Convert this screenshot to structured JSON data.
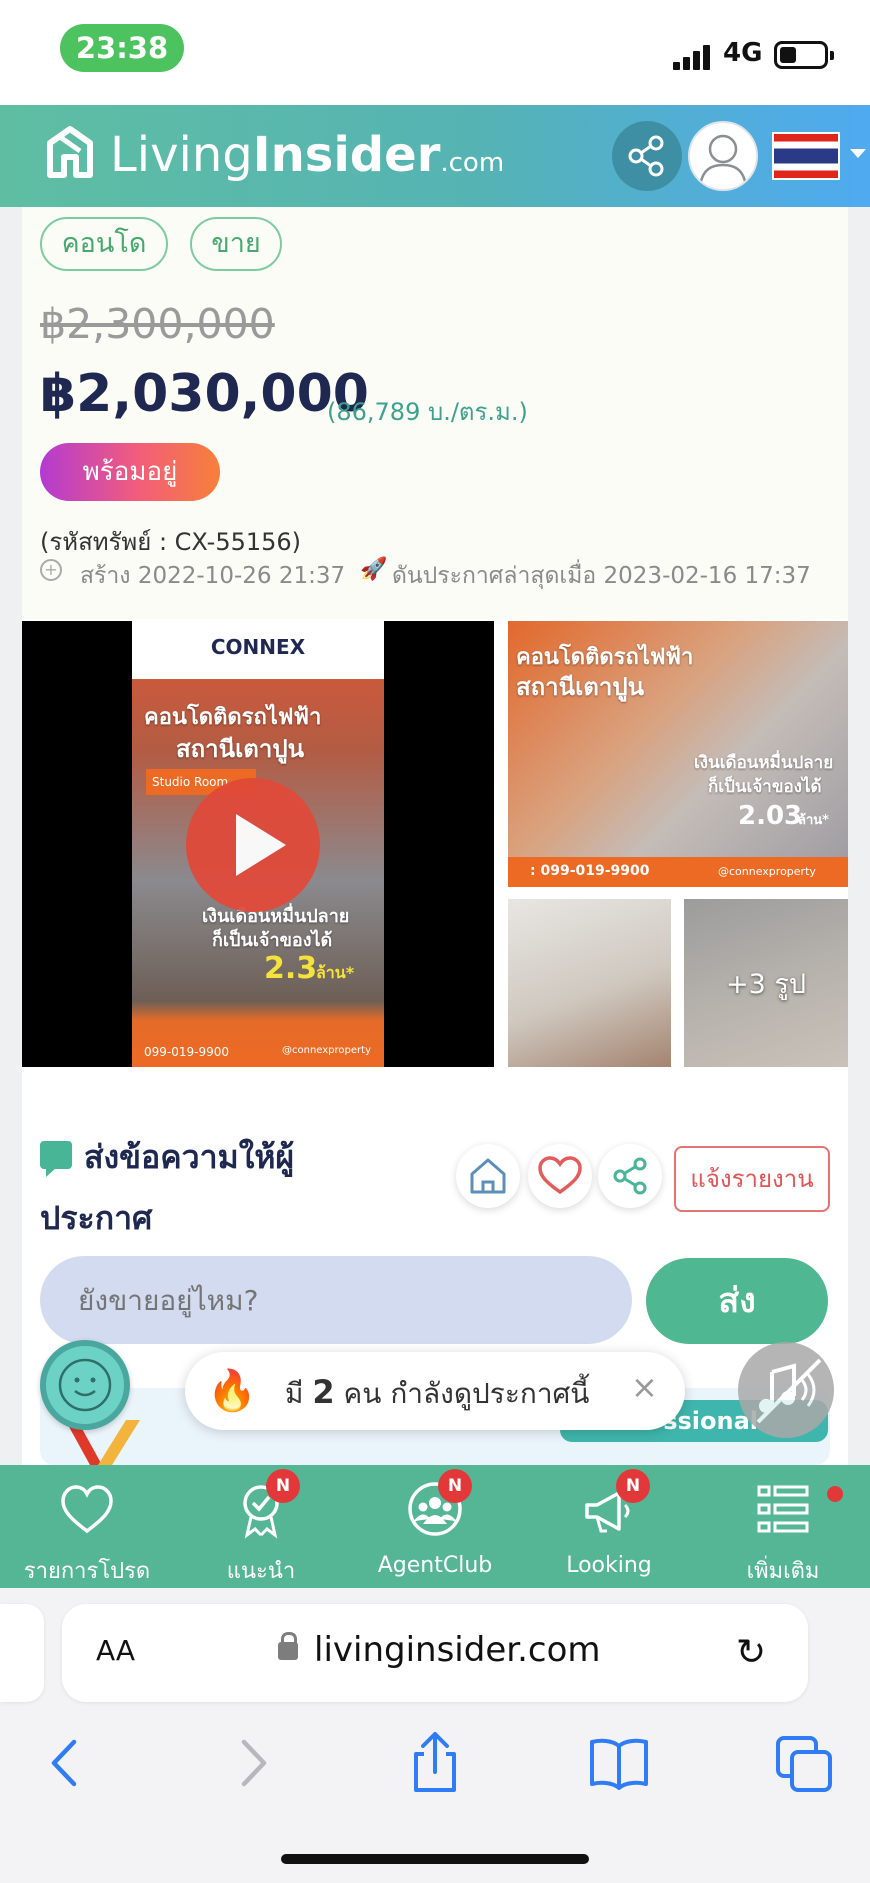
{
  "status_bar": {
    "time": "23:38",
    "network": "4G"
  },
  "header": {
    "logo_light": "Living",
    "logo_bold": "Insider",
    "logo_suffix": ".com",
    "icons": [
      "share-icon",
      "avatar",
      "thai-flag",
      "chevron-down-icon"
    ]
  },
  "listing": {
    "tags": [
      "คอนโด",
      "ขาย"
    ],
    "old_price": "฿2,300,000",
    "price": "฿2,030,000",
    "price_per_sqm": "(86,789 บ./ตร.ม.)",
    "ready_label": "พร้อมอยู่",
    "asset_code": "(รหัสทรัพย์ : CX-55156)",
    "created": "สร้าง 2022-10-26 21:37",
    "bumped": "ดันประกาศล่าสุดเมื่อ 2023-02-16 17:37"
  },
  "gallery": {
    "video": {
      "brand": "CONNEX",
      "headline_1": "คอนโดติดรถไฟฟ้า",
      "headline_2": "สถานีเตาปูน",
      "room": "Studio Room",
      "tagline_1": "เงินเดือนหมื่นปลาย",
      "tagline_2": "ก็เป็นเจ้าของได้",
      "price": "2.3",
      "price_unit": "ล้าน*",
      "phone": "099-019-9900",
      "handle": "@connexproperty"
    },
    "main_image": {
      "headline_1": "คอนโดติดรถไฟฟ้า",
      "headline_2": "สถานีเตาปูน",
      "tagline_1": "เงินเดือนหมื่นปลาย",
      "tagline_2": "ก็เป็นเจ้าของได้",
      "price": "2.03",
      "price_unit": "ล้าน*",
      "phone": ": 099-019-9900",
      "handle": "@connexproperty"
    },
    "more_photos": "+3 รูป"
  },
  "message": {
    "title_line1": "ส่งข้อความให้ผู้",
    "title_line2": "ประกาศ",
    "report_label": "แจ้งรายงาน",
    "input_placeholder": "ยังขายอยู่ไหม?",
    "send_label": "ส่ง",
    "pro_badge": "ssional"
  },
  "viewers_toast": {
    "prefix": "มี",
    "count": "2",
    "suffix": "คน กำลังดูประกาศนี้",
    "close": "×"
  },
  "app_nav": {
    "items": [
      {
        "label": "รายการโปรด",
        "icon": "heart-icon",
        "badge": ""
      },
      {
        "label": "แนะนำ",
        "icon": "award-icon",
        "badge": "N"
      },
      {
        "label": "AgentClub",
        "icon": "group-icon",
        "badge": "N"
      },
      {
        "label": "Looking",
        "icon": "megaphone-icon",
        "badge": "N"
      },
      {
        "label": "เพิ่มเติม",
        "icon": "list-icon",
        "badge": ""
      }
    ]
  },
  "browser": {
    "aa_label": "AA",
    "url": "livinginsider.com"
  },
  "colors": {
    "brand_green": "#55b695",
    "price_navy": "#1f2850",
    "accent_red": "#e2383a"
  }
}
